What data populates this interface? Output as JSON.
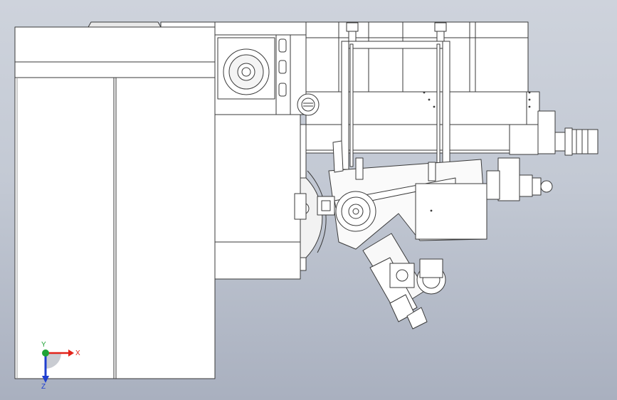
{
  "triad": {
    "x_label": "X",
    "y_label": "Y",
    "z_label": "Z",
    "x_color": "#e2231a",
    "y_color": "#1fa336",
    "z_color": "#1f3fcf"
  },
  "colors": {
    "line": "#3a3a3a",
    "fill": "#ffffff",
    "shade": "#e4e4e4",
    "background_top": "#ced3dc",
    "background_bottom": "#a9b0bf"
  }
}
